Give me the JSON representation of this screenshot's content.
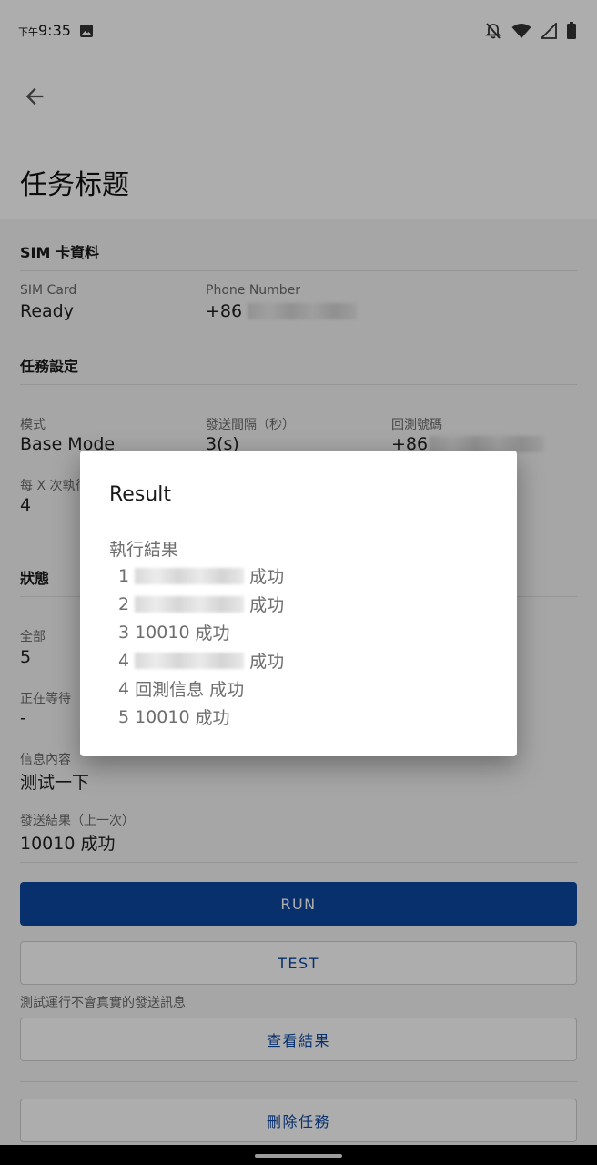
{
  "status_bar": {
    "time_prefix": "下午",
    "time": "9:35"
  },
  "app_bar": {
    "title": "任务标题"
  },
  "sim_section": {
    "heading": "SIM 卡資料",
    "sim_card_label": "SIM Card",
    "sim_card_value": "Ready",
    "phone_label": "Phone Number",
    "phone_value_prefix": "+86"
  },
  "task_section": {
    "heading": "任務設定",
    "mode_label": "模式",
    "mode_value": "Base Mode",
    "interval_label": "發送間隔（秒）",
    "interval_value": "3(s)",
    "callback_label": "回測號碼",
    "callback_value_prefix": "+86",
    "every_label": "每 X 次執行",
    "every_value": "4"
  },
  "status_section": {
    "heading": "狀態",
    "all_label": "全部",
    "all_value": "5",
    "waiting_label": "正在等待",
    "waiting_value": "-",
    "message_label": "信息內容",
    "message_value": "测试一下",
    "last_result_label": "發送結果（上一次）",
    "last_result_value": "10010 成功"
  },
  "buttons": {
    "run": "RUN",
    "test": "TEST",
    "test_note": "測試運行不會真實的發送訊息",
    "view_results": "查看結果",
    "delete_task": "刪除任務"
  },
  "dialog": {
    "title": "Result",
    "heading": "執行結果",
    "rows": [
      {
        "index": "1",
        "number": "",
        "status": "成功"
      },
      {
        "index": "2",
        "number": "",
        "status": "成功"
      },
      {
        "index": "3",
        "number": "10010",
        "status": "成功"
      },
      {
        "index": "4",
        "number": "",
        "status": "成功"
      },
      {
        "index": "4",
        "number": "回測信息",
        "status": "成功"
      },
      {
        "index": "5",
        "number": "10010",
        "status": "成功"
      }
    ]
  }
}
